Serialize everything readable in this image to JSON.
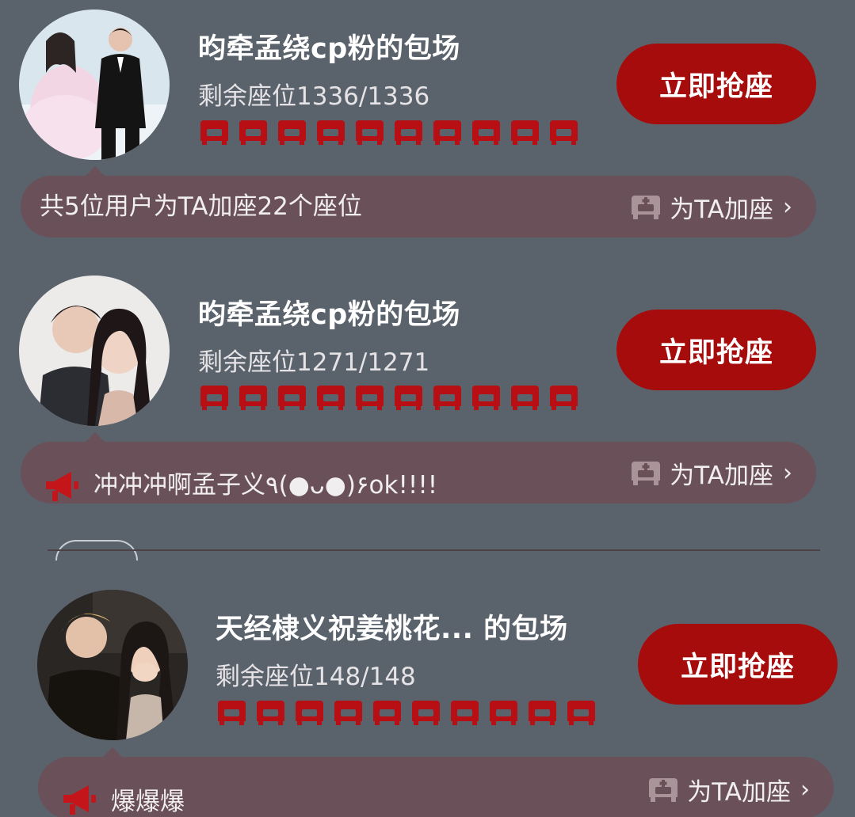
{
  "cards": [
    {
      "title": "昀牵孟绕cp粉的包场",
      "remaining": "剩余座位1336/1336",
      "button": "立即抢座",
      "avatar_icon": "couple-avatar-wedding",
      "bubble_text": "共5位用户为TA加座22个座位",
      "add_seat_label": "为TA加座"
    },
    {
      "title": "昀牵孟绕cp粉的包场",
      "remaining": "剩余座位1271/1271",
      "button": "立即抢座",
      "avatar_icon": "couple-avatar-portrait",
      "bubble_text": "冲冲冲啊孟子义٩(●ᴗ●)۶ok!!!!",
      "add_seat_label": "为TA加座"
    },
    {
      "title": "天经棣义祝姜桃花... 的包场",
      "remaining": "剩余座位148/148",
      "button": "立即抢座",
      "avatar_icon": "couple-avatar-event",
      "bubble_text": "爆爆爆",
      "add_seat_label": "为TA加座"
    }
  ],
  "colors": {
    "background": "#5a626c",
    "accent_red": "#a60c0c",
    "seat_red": "#b70f13",
    "bubble": "#6a5058"
  }
}
